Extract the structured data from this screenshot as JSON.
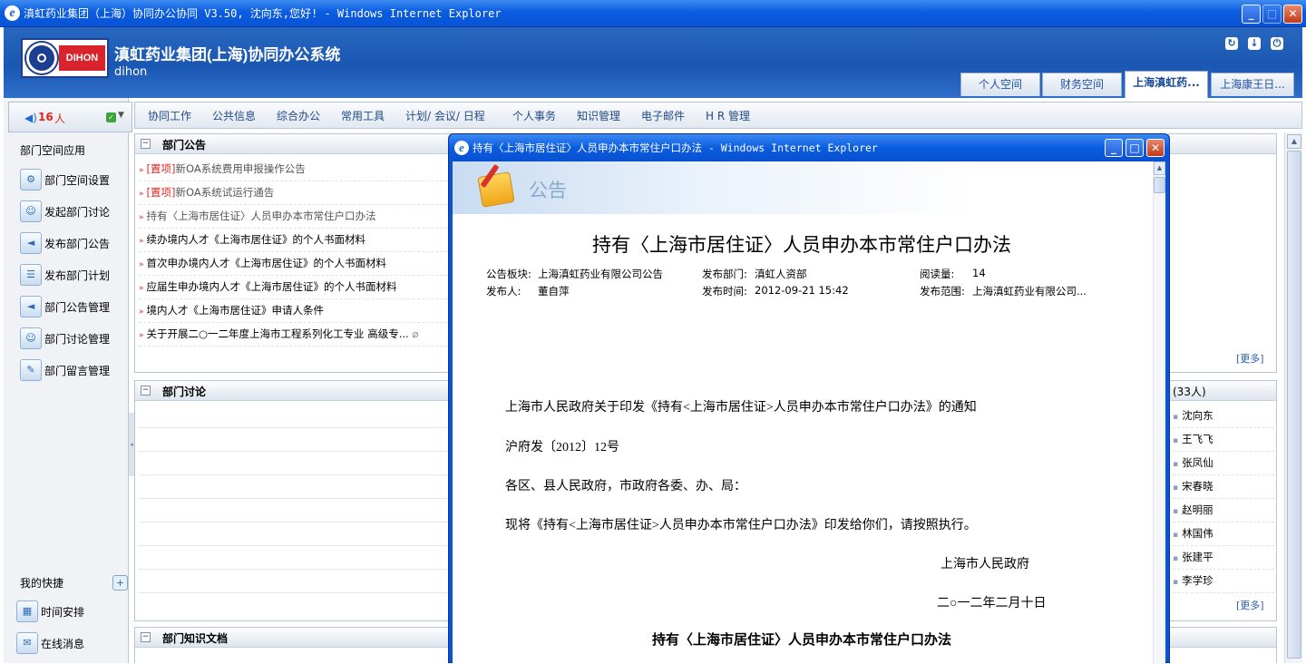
{
  "window": {
    "title": "滇虹药业集团（上海）协同办公协同 V3.50, 沈向东,您好! - Windows Internet Explorer"
  },
  "header": {
    "logo_text": "DIHON",
    "system_name": "滇虹药业集团(上海)协同办公系统",
    "subtitle": "dihon"
  },
  "tabs": [
    {
      "label": "个人空间"
    },
    {
      "label": "财务空间"
    },
    {
      "label": "上海滇虹药..."
    },
    {
      "label": "上海康王日..."
    }
  ],
  "online": {
    "count": "16",
    "unit": "人"
  },
  "menu": [
    "协同工作",
    "公共信息",
    "综合办公",
    "常用工具",
    "计划/ 会议/ 日程",
    "个人事务",
    "知识管理",
    "电子邮件",
    "H R 管理"
  ],
  "left_panel": {
    "header": "部门空间应用",
    "items": [
      "部门空间设置",
      "发起部门讨论",
      "发布部门公告",
      "发布部门计划",
      "部门公告管理",
      "部门讨论管理",
      "部门留言管理"
    ],
    "quick_header": "我的快捷",
    "quick_items": [
      "时间安排",
      "在线消息"
    ]
  },
  "announcements": {
    "title": "部门公告",
    "items": [
      {
        "tag": "[置项]",
        "text": "新OA系统费用申报操作公告"
      },
      {
        "tag": "[置项]",
        "text": "新OA系统试运行通告"
      },
      {
        "tag": "",
        "text": "持有〈上海市居住证〉人员申办本市常住户口办法"
      },
      {
        "tag": "",
        "text": "续办境内人才《上海市居住证》的个人书面材料"
      },
      {
        "tag": "",
        "text": "首次申办境内人才《上海市居住证》的个人书面材料"
      },
      {
        "tag": "",
        "text": "应届生申办境内人才《上海市居住证》的个人书面材料"
      },
      {
        "tag": "",
        "text": "境内人才《上海市居住证》申请人条件"
      },
      {
        "tag": "",
        "text": "关于开展二○一二年度上海市工程系列化工专业 高级专..."
      }
    ],
    "more": "[更多]"
  },
  "discussion": {
    "title": "部门讨论"
  },
  "knowledge": {
    "title": "部门知识文档"
  },
  "members": {
    "count_label": "(33人)",
    "names": [
      "沈向东",
      "王飞飞",
      "张凤仙",
      "宋春晓",
      "赵明丽",
      "林国伟",
      "张建平",
      "李学珍"
    ],
    "more": "[更多]"
  },
  "popup": {
    "title": "持有〈上海市居住证〉人员申办本市常住户口办法 - Windows Internet Explorer",
    "banner": "公告",
    "doc_title": "持有〈上海市居住证〉人员申办本市常住户口办法",
    "meta": {
      "board_label": "公告板块:",
      "board": "上海滇虹药业有限公司公告",
      "dept_label": "发布部门:",
      "dept": "滇虹人资部",
      "reads_label": "阅读量:",
      "reads": "14",
      "publisher_label": "发布人:",
      "publisher": "董自萍",
      "time_label": "发布时间:",
      "time": "2012-09-21 15:42",
      "scope_label": "发布范围:",
      "scope": "上海滇虹药业有限公司..."
    },
    "paragraphs": [
      "上海市人民政府关于印发《持有<上海市居住证>人员申办本市常住户口办法》的通知",
      "沪府发〔2012〕12号",
      "各区、县人民政府，市政府各委、办、局：",
      "现将《持有<上海市居住证>人员申办本市常住户口办法》印发给你们，请按照执行。"
    ],
    "signer": "上海市人民政府",
    "date": "二○一二年二月十日",
    "subtitle": "持有〈上海市居住证〉人员申办本市常住户口办法"
  }
}
